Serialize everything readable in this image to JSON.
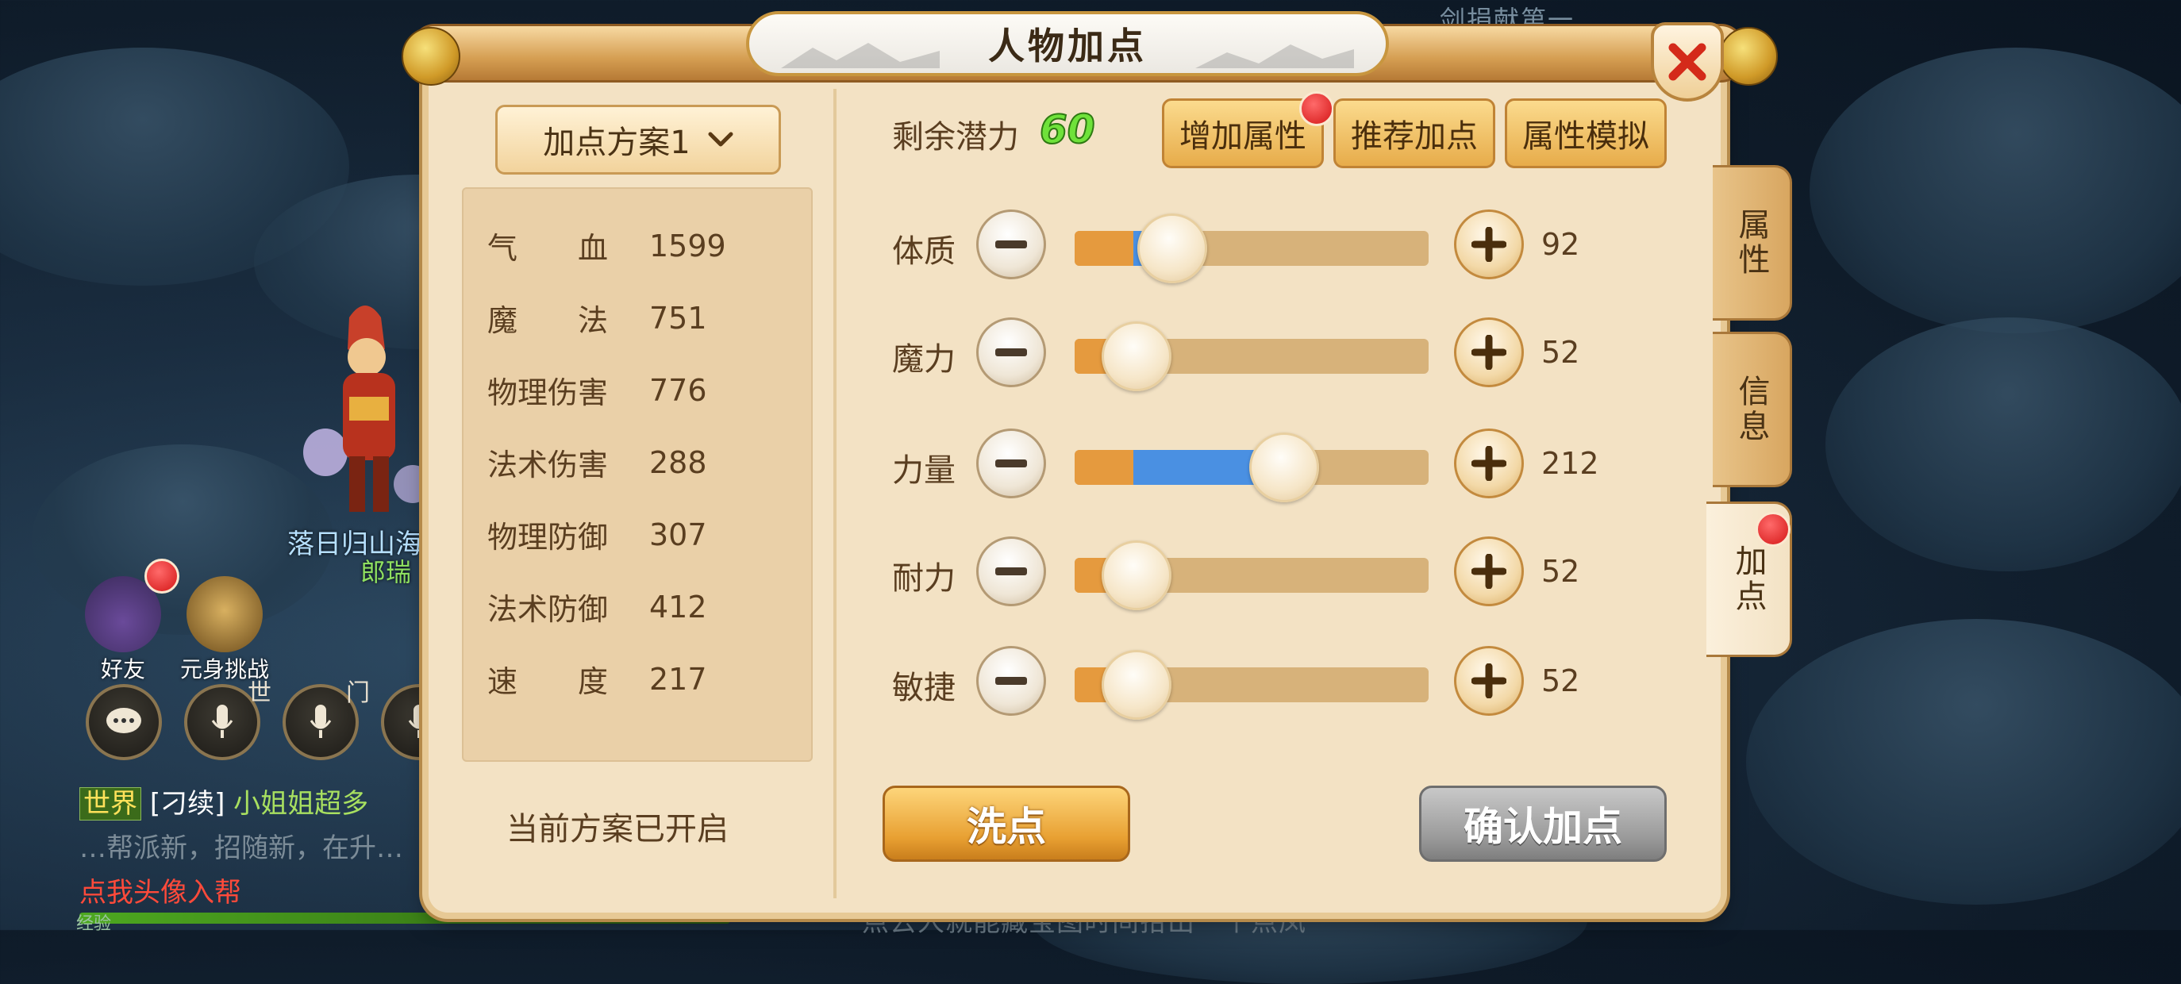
{
  "background": {
    "top_text": "…剑捐献第一",
    "character_name": "落日归山海",
    "character_title": "郎瑞",
    "hud_friend_label": "好友",
    "hud_challenge_label": "元身挑战",
    "voice_world_label": "世",
    "voice_guild_label": "门",
    "chat": {
      "channel": "世界",
      "line1_name": "[刁续]",
      "line1_text": "小姐姐超多",
      "line2_text": "…帮派新，招随新，在升…",
      "line3_text": "点我头像入帮"
    },
    "bottom_label": "经验",
    "bottom_text": "点去人就能藏宝图时间拾出一个点凤"
  },
  "dialog": {
    "title": "人物加点",
    "scheme_selector": "加点方案1",
    "stats": [
      {
        "label": "气　　血",
        "value": "1599"
      },
      {
        "label": "魔　　法",
        "value": "751"
      },
      {
        "label": "物理伤害",
        "value": "776"
      },
      {
        "label": "法术伤害",
        "value": "288"
      },
      {
        "label": "物理防御",
        "value": "307"
      },
      {
        "label": "法术防御",
        "value": "412"
      },
      {
        "label": "速　　度",
        "value": "217"
      }
    ],
    "scheme_status": "当前方案已开启",
    "potential_label": "剩余潜力",
    "potential_value": "60",
    "top_buttons": {
      "add_attr": "增加属性",
      "recommend": "推荐加点",
      "simulate": "属性模拟"
    },
    "attributes": [
      {
        "label": "体质",
        "value": "92",
        "level": 0.12,
        "base_level": 0.0
      },
      {
        "label": "魔力",
        "value": "52",
        "level": 0.0,
        "base_level": 0.0
      },
      {
        "label": "力量",
        "value": "212",
        "level": 0.5,
        "base_level": 0.0
      },
      {
        "label": "耐力",
        "value": "52",
        "level": 0.0,
        "base_level": 0.0
      },
      {
        "label": "敏捷",
        "value": "52",
        "level": 0.0,
        "base_level": 0.0
      }
    ],
    "wash_button": "洗点",
    "confirm_button": "确认加点",
    "side_tabs": [
      "属性",
      "信息",
      "加点"
    ],
    "active_tab": "加点"
  },
  "colors": {
    "potential": "#6fe23a",
    "fill_base": "#e59a3e",
    "fill_added": "#4a90e2",
    "red_dot": "#d41616"
  }
}
